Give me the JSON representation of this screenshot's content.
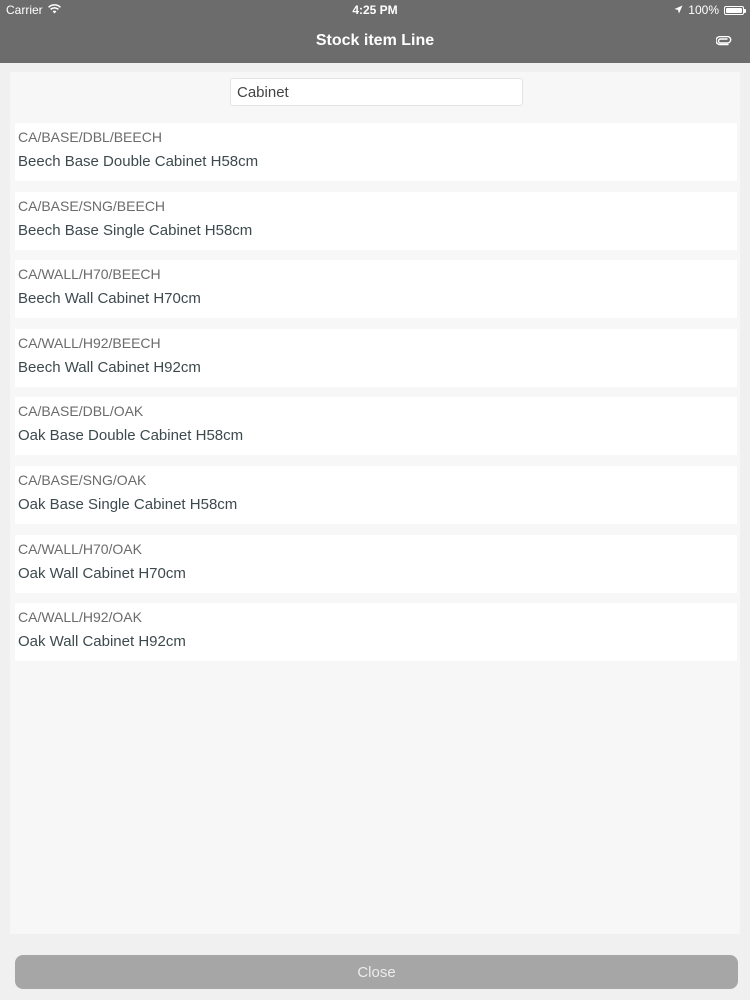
{
  "status_bar": {
    "carrier": "Carrier",
    "time": "4:25 PM",
    "battery": "100%",
    "icons": [
      "wifi-icon",
      "location-arrow-icon",
      "battery-icon"
    ]
  },
  "nav": {
    "title": "Stock item Line",
    "action_icon": "paperclip-icon"
  },
  "search": {
    "value": "Cabinet"
  },
  "items": [
    {
      "code": "CA/BASE/DBL/BEECH",
      "description": "Beech Base Double Cabinet H58cm"
    },
    {
      "code": "CA/BASE/SNG/BEECH",
      "description": "Beech Base Single Cabinet H58cm"
    },
    {
      "code": "CA/WALL/H70/BEECH",
      "description": "Beech Wall Cabinet H70cm"
    },
    {
      "code": "CA/WALL/H92/BEECH",
      "description": "Beech Wall Cabinet H92cm"
    },
    {
      "code": "CA/BASE/DBL/OAK",
      "description": "Oak Base Double Cabinet H58cm"
    },
    {
      "code": "CA/BASE/SNG/OAK",
      "description": "Oak Base Single Cabinet H58cm"
    },
    {
      "code": "CA/WALL/H70/OAK",
      "description": "Oak Wall Cabinet H70cm"
    },
    {
      "code": "CA/WALL/H92/OAK",
      "description": "Oak Wall Cabinet H92cm"
    }
  ],
  "footer": {
    "close_label": "Close"
  },
  "colors": {
    "nav_background": "#6c6c6c",
    "page_background": "#f0f0f0",
    "close_button": "#a6a6a6"
  }
}
